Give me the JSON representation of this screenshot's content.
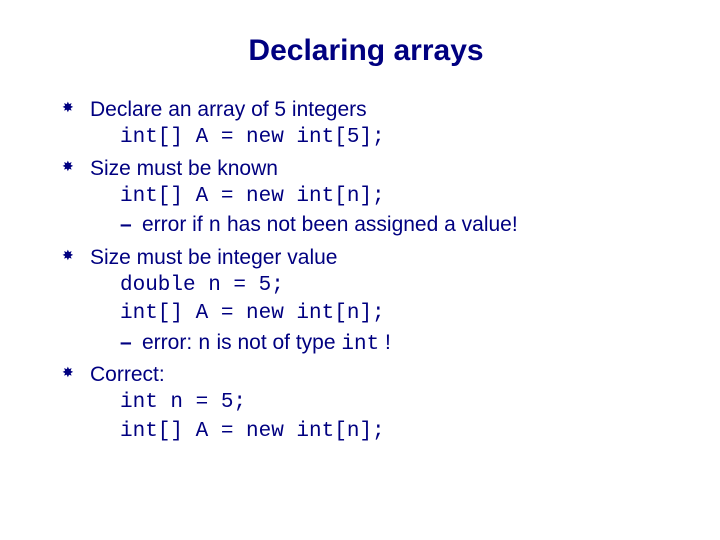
{
  "title": "Declaring arrays",
  "b1": {
    "head": "Declare an array of 5 integers",
    "code1": "int[] A = new int[5];"
  },
  "b2": {
    "head": "Size must be known",
    "code1": "int[] A = new int[n];",
    "sub_pre": "error if ",
    "sub_code": "n",
    "sub_post": " has not been assigned a value!"
  },
  "b3": {
    "head": "Size must be integer value",
    "code1": "double n = 5;",
    "code2": "int[] A = new int[n];",
    "sub_pre": "error: ",
    "sub_code1": "n",
    "sub_mid": " is not of type ",
    "sub_code2": "int",
    "sub_post": " !"
  },
  "b4": {
    "head": "Correct:",
    "code1": "int n = 5;",
    "code2": "int[] A = new int[n];"
  }
}
